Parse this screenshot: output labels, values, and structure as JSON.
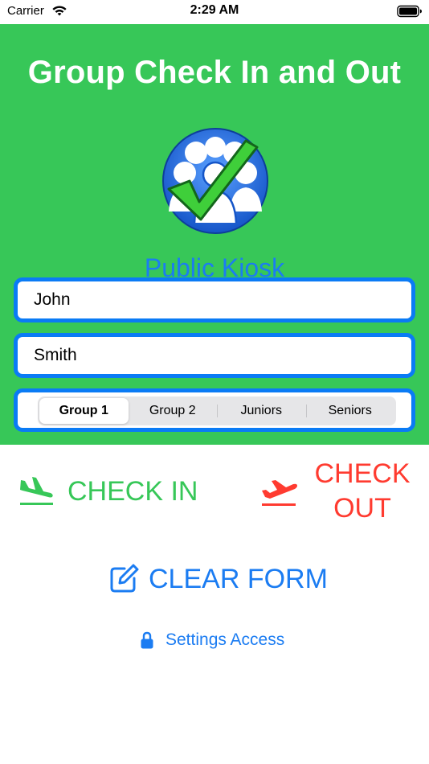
{
  "status_bar": {
    "carrier": "Carrier",
    "time": "2:29 AM"
  },
  "header": {
    "title": "Group Check In and Out",
    "logo_icon": "group-check-logo-icon"
  },
  "kiosk": {
    "label": "Public Kiosk"
  },
  "form": {
    "first_name": {
      "value": "John"
    },
    "last_name": {
      "value": "Smith"
    }
  },
  "group_selector": {
    "selected": "Group 1",
    "options": [
      "Group 1",
      "Group 2",
      "Juniors",
      "Seniors"
    ]
  },
  "actions": {
    "check_in_label": "CHECK IN",
    "check_out_label_line1": "CHECK",
    "check_out_label_line2": "OUT",
    "clear_form_label": "CLEAR FORM",
    "settings_label": "Settings Access"
  },
  "colors": {
    "header_green": "#37c758",
    "field_border_blue": "#0a7bf5",
    "link_blue": "#1b7cf2",
    "check_out_red": "#ff3b30"
  },
  "icons": {
    "check_in": "plane-landing-icon",
    "check_out": "plane-takeoff-icon",
    "clear_form": "edit-square-icon",
    "settings": "lock-icon"
  }
}
